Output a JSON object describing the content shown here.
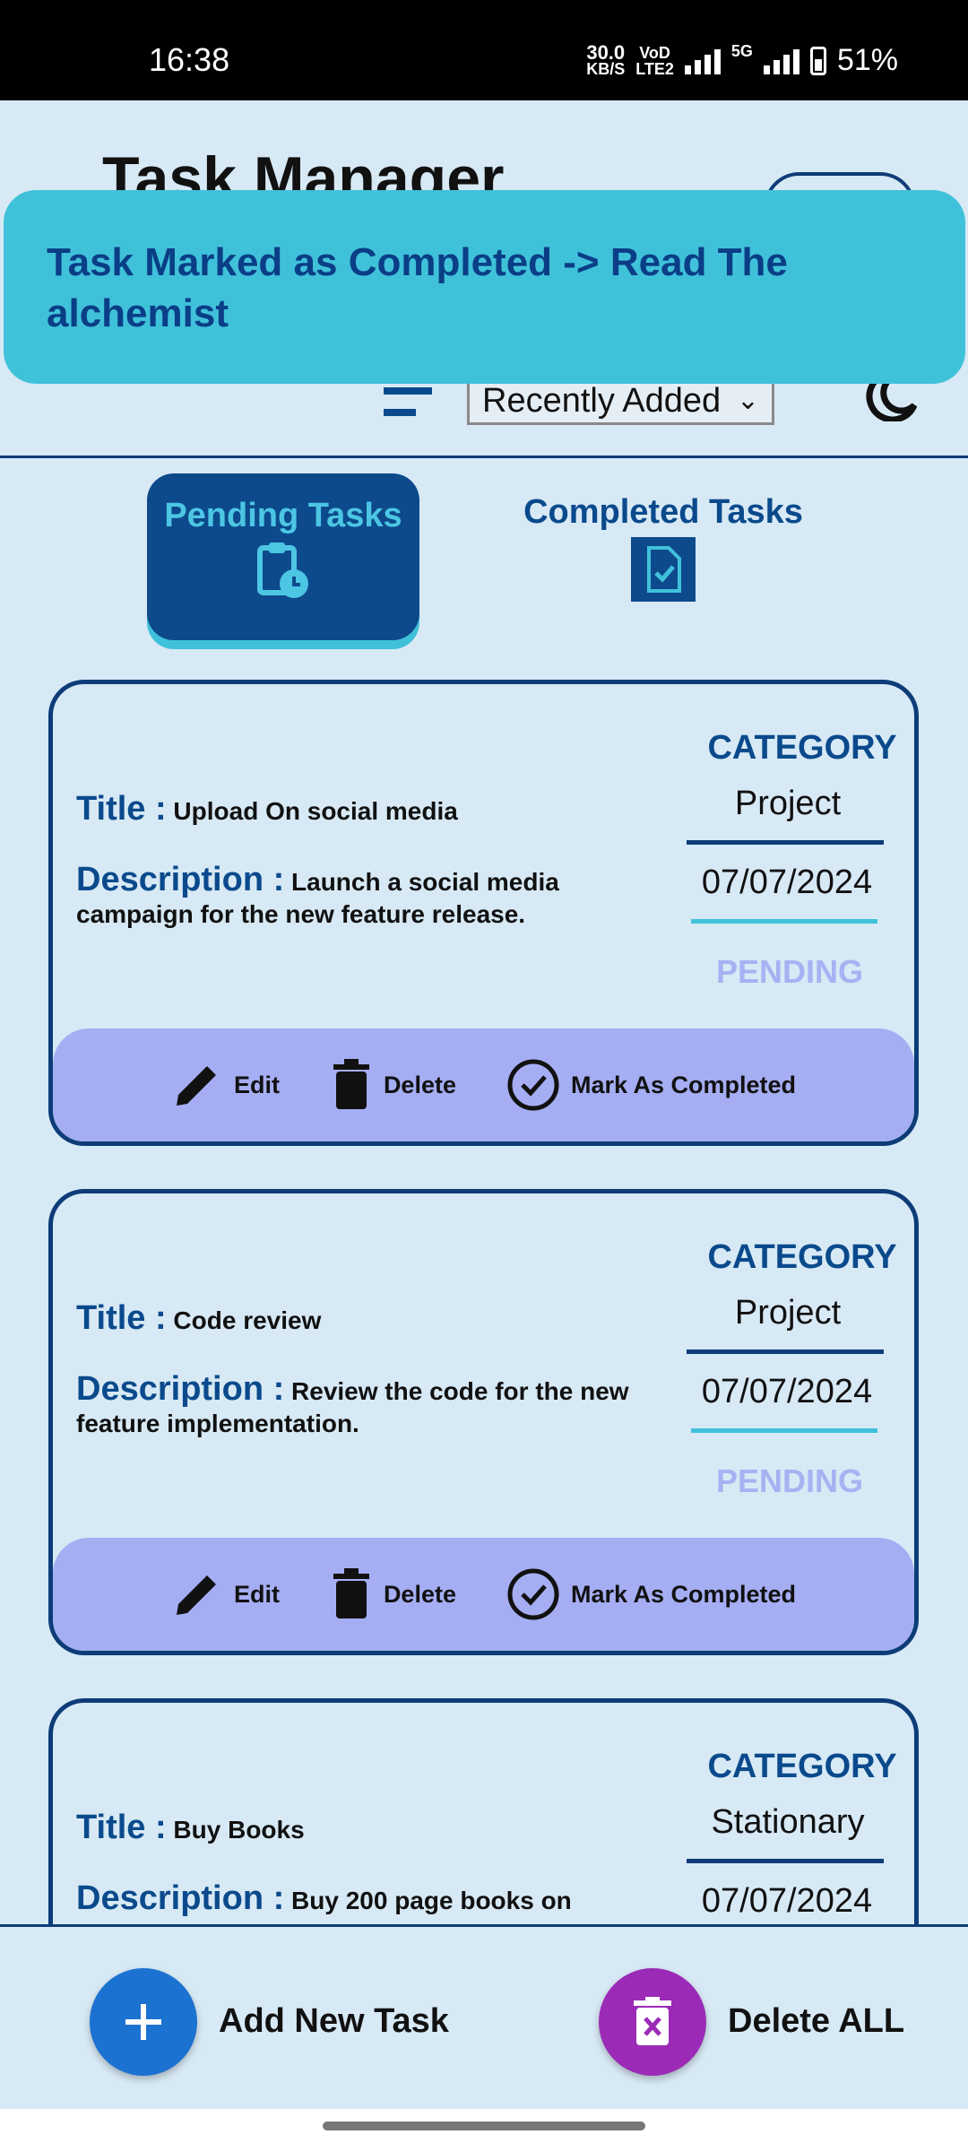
{
  "status_bar": {
    "time": "16:38",
    "net_speed_value": "30.0",
    "net_speed_unit": "KB/S",
    "volte_top": "VoD",
    "volte_bottom": "LTE2",
    "network_5g": "5G",
    "battery": "51%"
  },
  "header": {
    "title": "Task Manager",
    "sort_selected": "Recently Added"
  },
  "toast": {
    "message": "Task Marked as Completed -> Read The alchemist"
  },
  "tabs": {
    "pending": "Pending Tasks",
    "completed": "Completed Tasks"
  },
  "labels": {
    "title": "Title :",
    "description": "Description :",
    "category": "CATEGORY",
    "edit": "Edit",
    "delete": "Delete",
    "mark_completed": "Mark As Completed"
  },
  "tasks": [
    {
      "title": "Upload On social media",
      "description": "Launch a social media campaign for the new feature release.",
      "category": "Project",
      "date": "07/07/2024",
      "status": "PENDING"
    },
    {
      "title": "Code review",
      "description": "Review the code for the new feature implementation.",
      "category": "Project",
      "date": "07/07/2024",
      "status": "PENDING"
    },
    {
      "title": "Buy Books",
      "description": "Buy 200 page books on",
      "category": "Stationary",
      "date": "07/07/2024"
    }
  ],
  "bottom": {
    "add_label": "Add New Task",
    "delete_all_label": "Delete ALL"
  },
  "colors": {
    "background": "#d7e9f5",
    "primary_dark": "#0d3c78",
    "accent_cyan": "#40c1da",
    "action_bar": "#a5aef3",
    "pending_status": "#a6b2f2",
    "fab_add": "#1c72d1",
    "fab_delete": "#9b2bb6"
  }
}
